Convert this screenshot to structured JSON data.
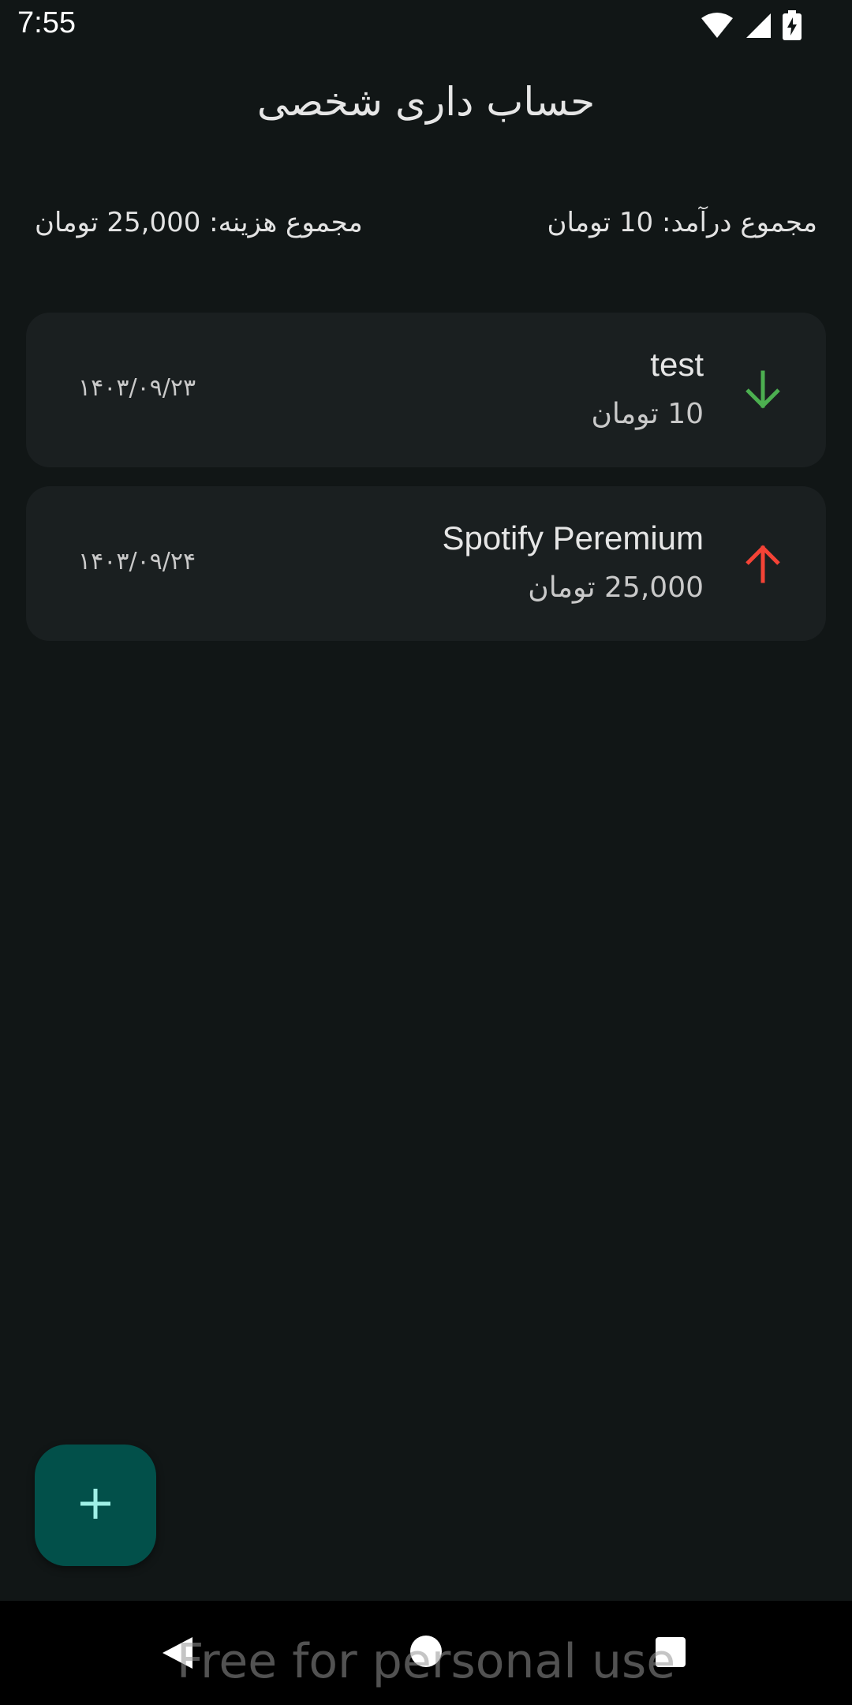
{
  "status_bar": {
    "time": "7:55",
    "icons": [
      "wifi-icon",
      "cellular-signal-icon",
      "battery-charging-icon"
    ]
  },
  "header": {
    "title": "حساب داری شخصی"
  },
  "totals": {
    "income_label": "مجموع درآمد: 10 تومان",
    "expense_label": "مجموع هزینه: 25,000 تومان"
  },
  "transactions": [
    {
      "title": "test",
      "amount": "10 تومان",
      "date": "۱۴۰۳/۰۹/۲۳",
      "type": "income",
      "icon": "arrow-down-icon",
      "icon_color": "#4caf50"
    },
    {
      "title": "Spotify Peremium",
      "amount": "25,000 تومان",
      "date": "۱۴۰۳/۰۹/۲۴",
      "type": "expense",
      "icon": "arrow-up-icon",
      "icon_color": "#f44336"
    }
  ],
  "fab": {
    "icon": "plus-icon",
    "color": "#02504a",
    "icon_color": "#9ff0e6"
  },
  "nav_bar": {
    "buttons": [
      "back-icon",
      "home-icon",
      "recents-icon"
    ]
  },
  "watermark": "Free for personal use",
  "colors": {
    "background": "#111616",
    "card": "#1a1f20",
    "income": "#4caf50",
    "expense": "#f44336"
  }
}
